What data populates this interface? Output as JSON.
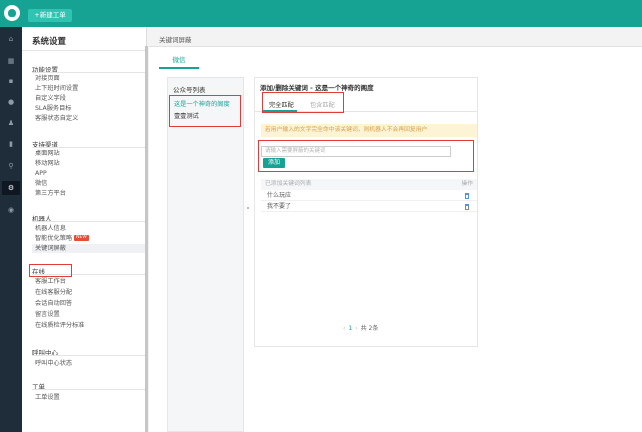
{
  "topbar": {
    "new_ticket_label": "+新建工单"
  },
  "rail": {
    "icons": [
      "home-icon",
      "dashboard-icon",
      "messages-icon",
      "user-icon",
      "contacts-icon",
      "stats-icon",
      "search-icon",
      "settings-icon",
      "help-icon"
    ]
  },
  "sidebar": {
    "title": "系统设置",
    "groups": [
      {
        "label": "功能设置",
        "items": [
          "对接页面",
          "上下班时间设置",
          "自定义字段",
          "SLA服务目标",
          "客服状态自定义"
        ]
      },
      {
        "label": "支持渠道",
        "items": [
          "桌面网站",
          "移动网站",
          "APP",
          "微信",
          "第三方平台"
        ]
      },
      {
        "label": "机器人",
        "items": [
          "机器人信息",
          "智能优化策略",
          "关键词屏蔽"
        ]
      },
      {
        "label": "在线",
        "items": [
          "客服工作台",
          "在线客服分配",
          "会话自动回答",
          "留言设置",
          "在线质检评分标准"
        ]
      },
      {
        "label": "呼叫中心",
        "items": [
          "呼叫中心状态"
        ]
      },
      {
        "label": "工单",
        "items": [
          "工单设置"
        ]
      }
    ],
    "new_badge": "NEW"
  },
  "main": {
    "title": "关键词屏蔽",
    "tab_wechat": "微信",
    "accounts": {
      "title": "公众号列表",
      "items": [
        "这是一个神奇的阁度",
        "壹壹测试"
      ]
    },
    "keywords": {
      "title": "添加/删除关键词 - 这是一个神奇的阁度",
      "tab_exact": "完全匹配",
      "tab_fuzzy": "包含匹配",
      "notice": "若用户输入的文字完全命中该关键词，则机器人不会再回复用户",
      "input_placeholder": "请输入需要屏蔽的关键词",
      "add_label": "添加",
      "list_header": "已添加关键词列表",
      "list_op": "操作",
      "rows": [
        "什么玩应",
        "我不要了"
      ],
      "pager": {
        "prev": "‹",
        "page": "1",
        "next": "›",
        "total": "共 2条"
      }
    }
  }
}
